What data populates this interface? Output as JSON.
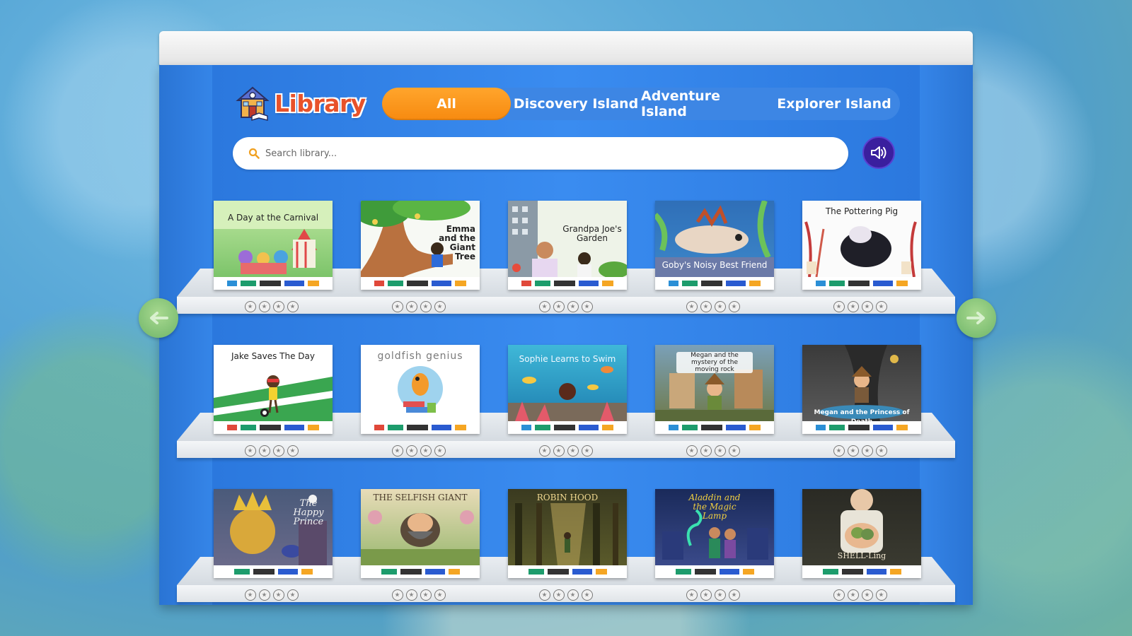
{
  "header": {
    "title": "Library",
    "tabs": [
      {
        "label": "All",
        "active": true
      },
      {
        "label": "Discovery Island",
        "active": false
      },
      {
        "label": "Adventure Island",
        "active": false
      },
      {
        "label": "Explorer Island",
        "active": false
      }
    ]
  },
  "search": {
    "placeholder": "Search library..."
  },
  "icons": {
    "library": "house-book-icon",
    "search": "search-icon",
    "audio": "speaker-icon",
    "prev": "arrow-left-icon",
    "next": "arrow-right-icon",
    "rating": "star-icon"
  },
  "colors": {
    "accent": "#f78a10",
    "bookcase": "#2f7fe0",
    "audio_button": "#3a1f9e",
    "arrow": "#7fbf72",
    "title": "#e8522a"
  },
  "shelves": [
    {
      "books": [
        {
          "title": "A Day at the Carnival",
          "stars": 0
        },
        {
          "title": "Emma and the Giant Tree",
          "stars": 0
        },
        {
          "title": "Grandpa Joe's Garden",
          "stars": 0
        },
        {
          "title": "Goby's Noisy Best Friend",
          "stars": 0
        },
        {
          "title": "The Pottering Pig",
          "stars": 0
        }
      ]
    },
    {
      "books": [
        {
          "title": "Jake Saves The Day",
          "stars": 0
        },
        {
          "title": "goldfish genius",
          "stars": 0
        },
        {
          "title": "Sophie Learns to Swim",
          "stars": 0
        },
        {
          "title": "Megan and the mystery of the moving rock",
          "stars": 0
        },
        {
          "title": "Megan and the Princess of Death",
          "stars": 0
        }
      ]
    },
    {
      "books": [
        {
          "title": "The Happy Prince",
          "stars": 0
        },
        {
          "title": "THE SELFISH GIANT",
          "stars": 0
        },
        {
          "title": "ROBIN HOOD",
          "stars": 0
        },
        {
          "title": "Aladdin and the Magic Lamp",
          "stars": 0
        },
        {
          "title": "SHELL-Ling",
          "stars": 0
        }
      ]
    }
  ]
}
